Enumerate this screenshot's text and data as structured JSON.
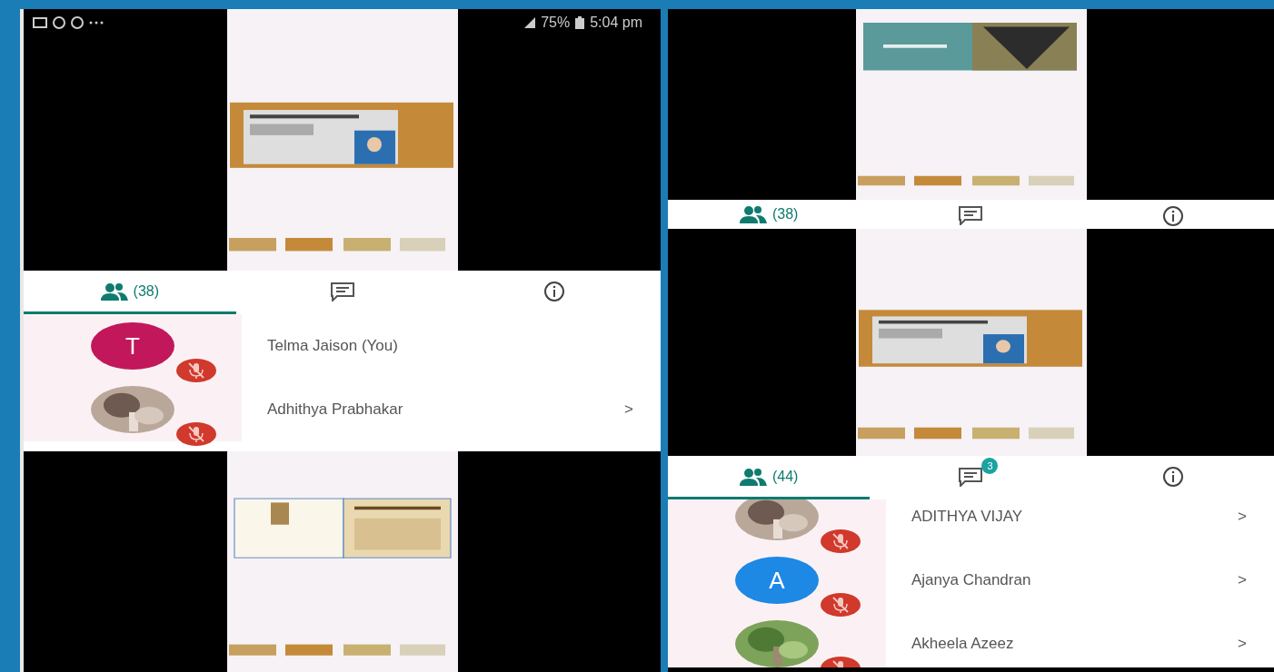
{
  "status_bar": {
    "battery": "75%",
    "time": "5:04 pm"
  },
  "panels": [
    {
      "tabs": [
        {
          "kind": "people",
          "label": "(38)",
          "selected": true
        },
        {
          "kind": "chat",
          "selected": false
        },
        {
          "kind": "info",
          "selected": false
        }
      ],
      "participants": [
        {
          "name": "Telma Jaison (You)",
          "kind": "letter",
          "letter": "T",
          "color": "#c2185b",
          "muted": true
        },
        {
          "name": "Adhithya Prabhakar",
          "muted": true,
          "chevron": ">"
        }
      ]
    },
    {
      "tabs": [
        {
          "kind": "people",
          "label": "(38)"
        },
        {
          "kind": "chat"
        },
        {
          "kind": "info"
        }
      ]
    },
    {
      "tabs": [
        {
          "kind": "people",
          "label": "(44)",
          "selected": true
        },
        {
          "kind": "chat",
          "badge": "3",
          "selected": false
        },
        {
          "kind": "info",
          "selected": false
        }
      ],
      "participants": [
        {
          "name": "ADITHYA VIJAY",
          "muted": true,
          "chevron": ">"
        },
        {
          "name": "Ajanya Chandran",
          "kind": "letter",
          "letter": "A",
          "color": "#1e88e5",
          "muted": true,
          "chevron": ">"
        },
        {
          "name": "Akheela Azeez",
          "muted": true,
          "chevron": ">"
        }
      ]
    }
  ]
}
